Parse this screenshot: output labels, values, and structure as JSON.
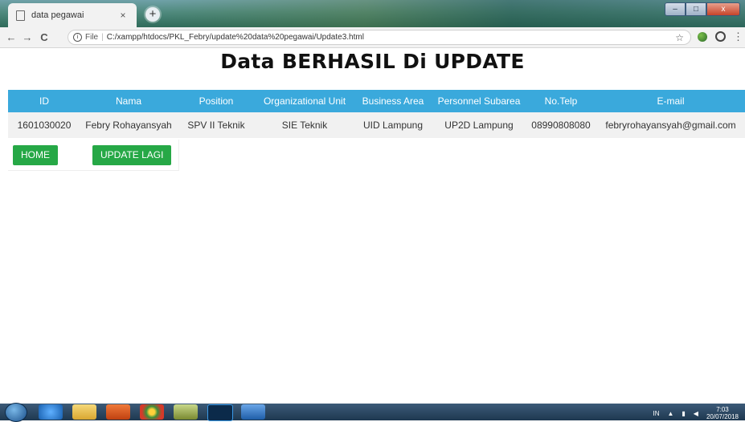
{
  "browser": {
    "tab_title": "data pegawai",
    "tab_close": "×",
    "new_tab": "+",
    "back": "←",
    "forward": "→",
    "reload": "C",
    "address_info": "i",
    "address_scheme": "File",
    "address_sep": "|",
    "url": "C:/xampp/htdocs/PKL_Febry/update%20data%20pegawai/Update3.html",
    "star": "☆",
    "menu": "⋮"
  },
  "page": {
    "heading": "Data BERHASIL Di UPDATE",
    "table": {
      "headers": [
        "ID",
        "Nama",
        "Position",
        "Organizational Unit",
        "Business Area",
        "Personnel Subarea",
        "No.Telp",
        "E-mail"
      ],
      "rows": [
        [
          "1601030020",
          "Febry Rohayansyah",
          "SPV II Teknik",
          "SIE Teknik",
          "UID Lampung",
          "UP2D Lampung",
          "08990808080",
          "febryrohayansyah@gmail.com"
        ]
      ]
    },
    "buttons": {
      "home": "HOME",
      "update_again": "UPDATE LAGI"
    }
  },
  "taskbar": {
    "lang": "IN",
    "time": "7:03",
    "date": "20/07/2018"
  },
  "colors": {
    "table_header": "#3aa9dc",
    "button": "#26a846"
  }
}
